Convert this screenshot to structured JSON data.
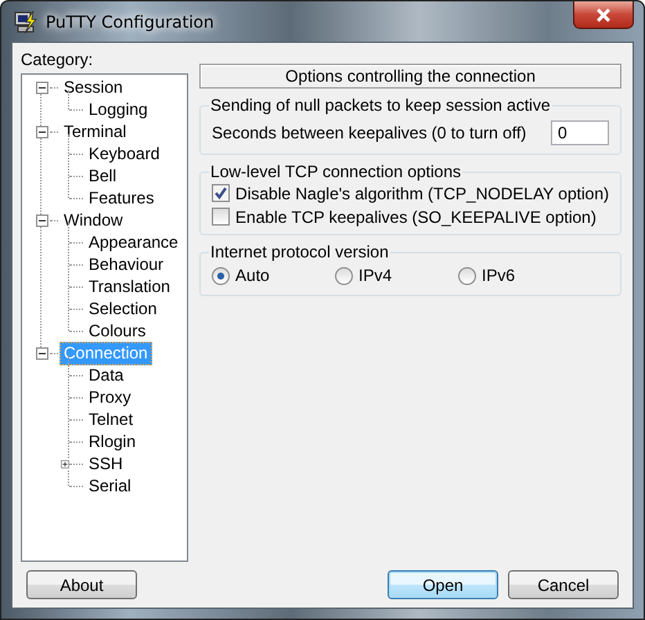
{
  "window": {
    "title": "PuTTY Configuration"
  },
  "category_label": "Category:",
  "tree": [
    {
      "label": "Session",
      "expanded": true,
      "selected": false,
      "children": [
        {
          "label": "Logging",
          "selected": false
        }
      ]
    },
    {
      "label": "Terminal",
      "expanded": true,
      "selected": false,
      "children": [
        {
          "label": "Keyboard",
          "selected": false
        },
        {
          "label": "Bell",
          "selected": false
        },
        {
          "label": "Features",
          "selected": false
        }
      ]
    },
    {
      "label": "Window",
      "expanded": true,
      "selected": false,
      "children": [
        {
          "label": "Appearance",
          "selected": false
        },
        {
          "label": "Behaviour",
          "selected": false
        },
        {
          "label": "Translation",
          "selected": false
        },
        {
          "label": "Selection",
          "selected": false
        },
        {
          "label": "Colours",
          "selected": false
        }
      ]
    },
    {
      "label": "Connection",
      "expanded": true,
      "selected": true,
      "children": [
        {
          "label": "Data",
          "selected": false
        },
        {
          "label": "Proxy",
          "selected": false
        },
        {
          "label": "Telnet",
          "selected": false
        },
        {
          "label": "Rlogin",
          "selected": false
        },
        {
          "label": "SSH",
          "expanded": false,
          "selected": false
        },
        {
          "label": "Serial",
          "selected": false
        }
      ]
    }
  ],
  "panel_title": "Options controlling the connection",
  "groups": [
    {
      "title": "Sending of null packets to keep session active",
      "controls": [
        {
          "kind": "field",
          "label": "Seconds between keepalives (0 to turn off)",
          "value": "0"
        }
      ]
    },
    {
      "title": "Low-level TCP connection options",
      "controls": [
        {
          "kind": "checkbox",
          "label": "Disable Nagle's algorithm (TCP_NODELAY option)",
          "checked": true
        },
        {
          "kind": "checkbox",
          "label": "Enable TCP keepalives (SO_KEEPALIVE option)",
          "checked": false
        }
      ]
    },
    {
      "title": "Internet protocol version",
      "controls": [
        {
          "kind": "radios",
          "options": [
            {
              "label": "Auto",
              "selected": true
            },
            {
              "label": "IPv4",
              "selected": false
            },
            {
              "label": "IPv6",
              "selected": false
            }
          ]
        }
      ]
    }
  ],
  "footer": {
    "left_buttons": [
      {
        "label": "About",
        "default": false
      }
    ],
    "right_buttons": [
      {
        "label": "Open",
        "default": true
      },
      {
        "label": "Cancel",
        "default": false
      }
    ]
  }
}
